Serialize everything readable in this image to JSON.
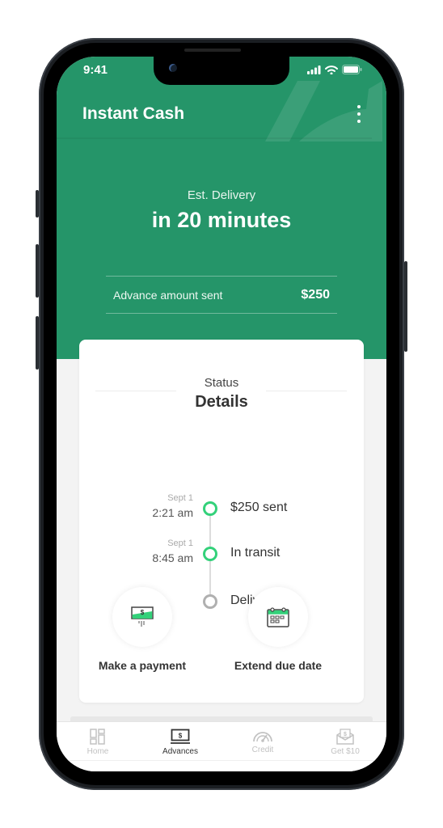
{
  "status_bar": {
    "time": "9:41"
  },
  "header": {
    "title": "Instant Cash",
    "menu_icon": "kebab-menu-icon"
  },
  "hero": {
    "eta_label": "Est. Delivery",
    "eta_value": "in 20 minutes",
    "amount_label": "Advance amount sent",
    "amount_value": "$250"
  },
  "status_card": {
    "subtitle": "Status",
    "title": "Details",
    "timeline": [
      {
        "date": "Sept 1",
        "time": "2:21 am",
        "label": "$250 sent",
        "state": "complete"
      },
      {
        "date": "Sept 1",
        "time": "8:45 am",
        "label": "In transit",
        "state": "complete"
      },
      {
        "date": "",
        "time": "",
        "label": "Delivered",
        "state": "pending"
      }
    ],
    "actions": [
      {
        "label": "Make a payment",
        "icon": "payment-icon"
      },
      {
        "label": "Extend due date",
        "icon": "calendar-icon"
      }
    ]
  },
  "tabbar": {
    "items": [
      {
        "label": "Home",
        "icon": "home-grid-icon",
        "active": false
      },
      {
        "label": "Advances",
        "icon": "advances-laptop-icon",
        "active": true
      },
      {
        "label": "Credit",
        "icon": "gauge-icon",
        "active": false
      },
      {
        "label": "Get $10",
        "icon": "envelope-dollar-icon",
        "active": false
      }
    ]
  },
  "colors": {
    "brand_green": "#259569",
    "success_green": "#33d17a",
    "pending_gray": "#b0b0b0"
  }
}
